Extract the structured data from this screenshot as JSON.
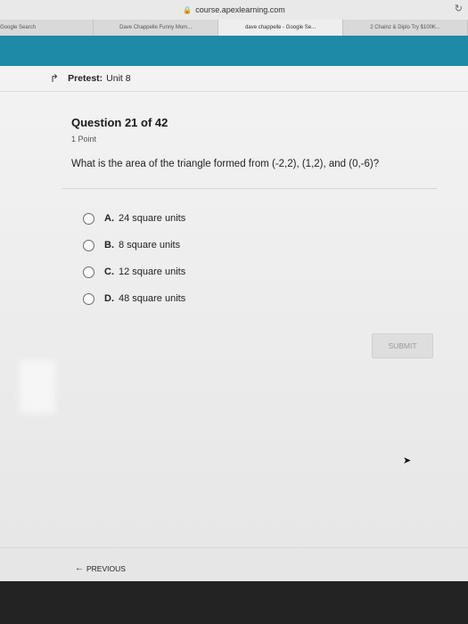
{
  "browser": {
    "url": "course.apexlearning.com",
    "tabs": [
      "Google Search",
      "Dave Chappelle Funny Mom...",
      "dave chappelle - Google Se...",
      "2 Chainz & Diplo Try $100K..."
    ]
  },
  "header": {
    "pretest_label": "Pretest:",
    "pretest_unit": "Unit 8"
  },
  "question": {
    "title": "Question 21 of 42",
    "points": "1 Point",
    "text": "What is the area of the triangle formed from (-2,2), (1,2), and (0,-6)?"
  },
  "options": [
    {
      "letter": "A.",
      "text": "24 square units"
    },
    {
      "letter": "B.",
      "text": "8 square units"
    },
    {
      "letter": "C.",
      "text": "12 square units"
    },
    {
      "letter": "D.",
      "text": "48 square units"
    }
  ],
  "actions": {
    "submit": "SUBMIT",
    "previous": "PREVIOUS"
  },
  "colors": {
    "header_bar": "#1f8aa8",
    "submit_disabled": "#dedede"
  },
  "icons": [
    "lock-icon",
    "reload-icon",
    "back-arrow-icon",
    "radio-icon",
    "left-arrow-icon",
    "cursor-icon"
  ]
}
